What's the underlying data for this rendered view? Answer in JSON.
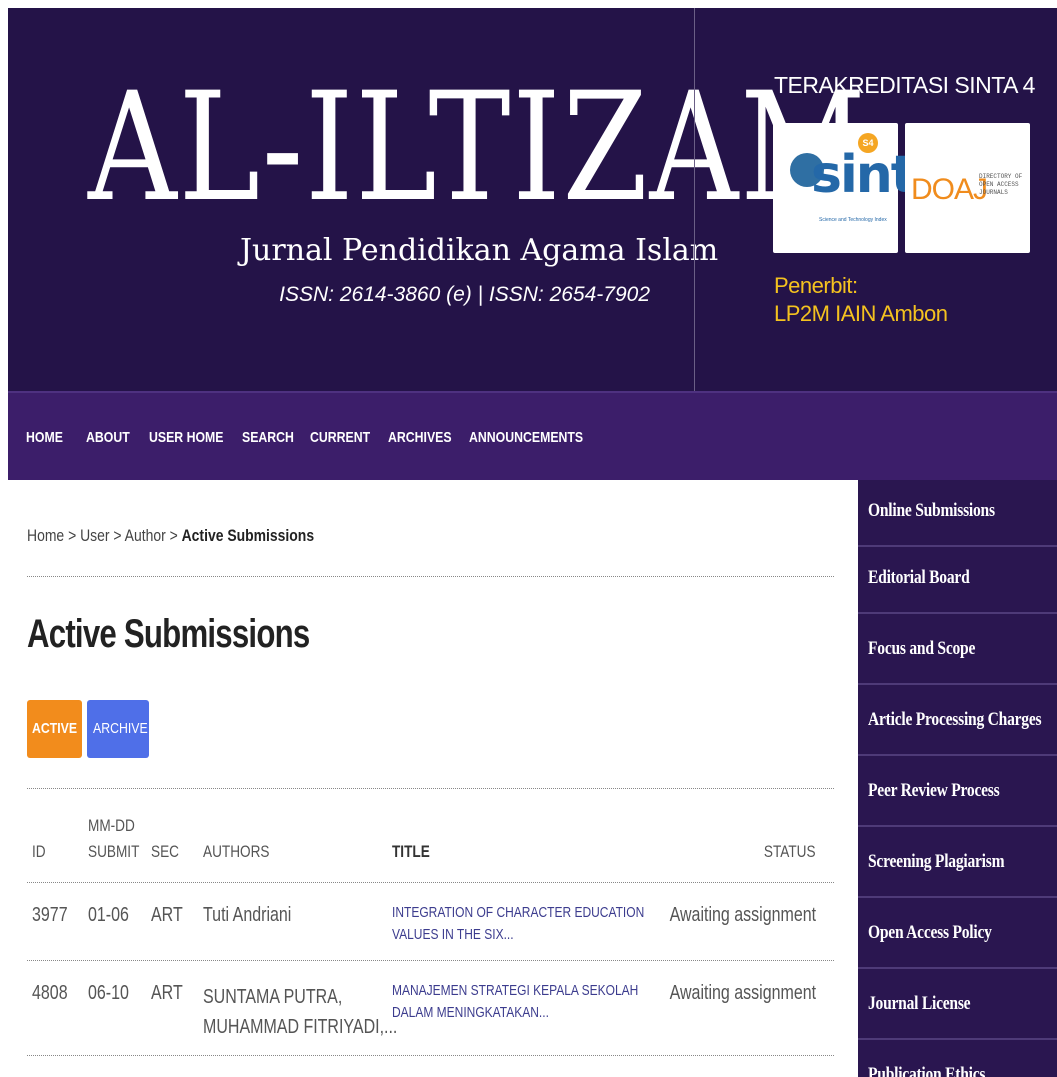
{
  "header": {
    "logo_title": "AL-ILTIZAM",
    "logo_subtitle": "Jurnal Pendidikan Agama Islam",
    "issn": "ISSN: 2614-3860 (e) | ISSN: 2654-7902",
    "accreditation": "TERAKREDITASI SINTA 4",
    "sinta_label": "sinta",
    "sinta_grade": "S4",
    "sinta_tagline": "Science and Technology Index",
    "doaj_label": "DOAJ",
    "doaj_tagline": "DIRECTORY OF OPEN ACCESS JOURNALS",
    "publisher_label": "Penerbit:",
    "publisher_name": "LP2M IAIN Ambon"
  },
  "nav": {
    "items": [
      "HOME",
      "ABOUT",
      "USER HOME",
      "SEARCH",
      "CURRENT",
      "ARCHIVES",
      "ANNOUNCEMENTS"
    ]
  },
  "breadcrumb": {
    "home": "Home",
    "sep1": " > ",
    "user": "User",
    "sep2": " > ",
    "author": "Author",
    "sep3": " > ",
    "current": "Active Submissions"
  },
  "page": {
    "title": "Active Submissions",
    "tabs": {
      "active": "ACTIVE",
      "archive": "ARCHIVE"
    }
  },
  "table": {
    "headers": {
      "id": "ID",
      "date_top": "MM-DD",
      "date_bottom": "SUBMIT",
      "sec": "SEC",
      "authors": "AUTHORS",
      "title": "TITLE",
      "status": "STATUS"
    },
    "rows": [
      {
        "id": "3977",
        "date": "01-06",
        "sec": "ART",
        "authors_1": "Tuti Andriani",
        "authors_2": "",
        "title_1": "INTEGRATION OF CHARACTER EDUCATION",
        "title_2": "VALUES IN THE SIX...",
        "status": "Awaiting assignment"
      },
      {
        "id": "4808",
        "date": "06-10",
        "sec": "ART",
        "authors_1": "SUNTAMA PUTRA,",
        "authors_2": "MUHAMMAD FITRIYADI,...",
        "title_1": "MANAJEMEN STRATEGI KEPALA SEKOLAH",
        "title_2": "DALAM MENINGKATAKAN...",
        "status": "Awaiting assignment"
      }
    ]
  },
  "sidebar": {
    "items": [
      "Online Submissions",
      "Editorial Board",
      "Focus and Scope",
      "Article Processing Charges",
      "Peer Review Process",
      "Screening Plagiarism",
      "Open Access Policy",
      "Journal License",
      "Publication Ethics"
    ]
  }
}
